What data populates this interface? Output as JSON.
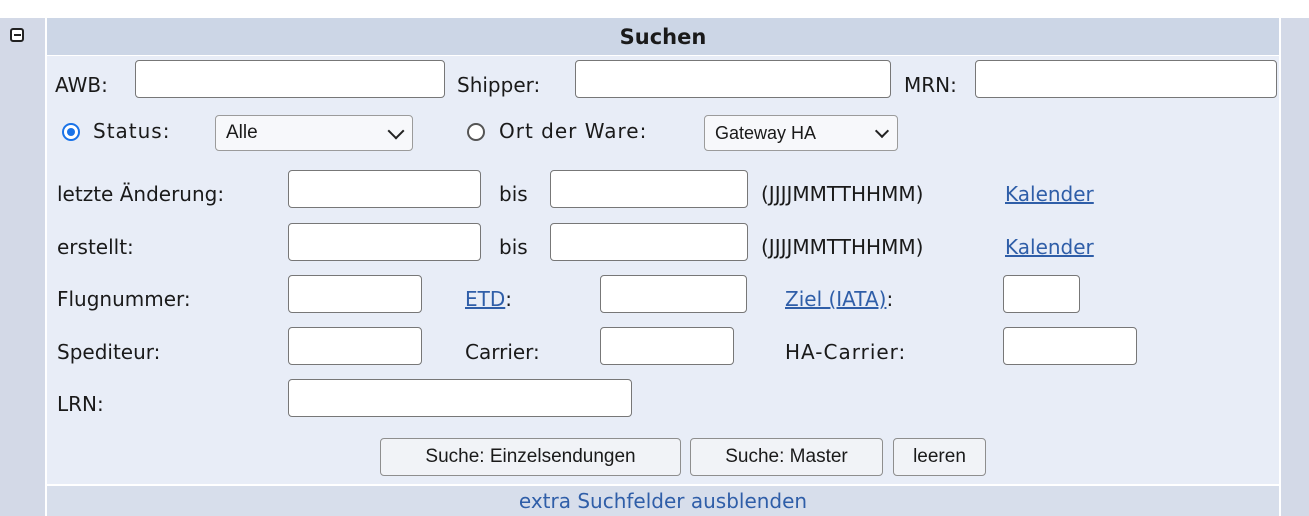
{
  "header": {
    "title": "Suchen"
  },
  "row1": {
    "awb_label": "AWB:",
    "awb_value": "",
    "shipper_label": "Shipper:",
    "shipper_value": "",
    "mrn_label": "MRN:",
    "mrn_value": ""
  },
  "row2": {
    "status_label": "Status:",
    "status_selected": "Alle",
    "status_checked": true,
    "ort_label": "Ort der Ware:",
    "ort_selected": "Gateway HA",
    "ort_checked": false
  },
  "row3": {
    "label": "letzte Änderung:",
    "bis": "bis",
    "format": "(JJJJMMTTHHMM)",
    "kalender": "Kalender"
  },
  "row4": {
    "label": "erstellt:",
    "bis": "bis",
    "format": "(JJJJMMTTHHMM)",
    "kalender": "Kalender"
  },
  "row5": {
    "flugnummer": "Flugnummer:",
    "etd": "ETD",
    "ziel": "Ziel (IATA)",
    "colon": ":"
  },
  "row6": {
    "spediteur": "Spediteur:",
    "carrier": "Carrier:",
    "ha_carrier": "HA-Carrier:"
  },
  "row7": {
    "lrn": "LRN:"
  },
  "buttons": {
    "einzel": "Suche: Einzelsendungen",
    "master": "Suche: Master",
    "leeren": "leeren"
  },
  "footer": {
    "toggle": "extra Suchfelder ausblenden"
  },
  "colors": {
    "accent": "#1a73e8",
    "link": "#2f5ea8",
    "panel": "#e8edf7",
    "header": "#ccd6e6"
  },
  "icons": {
    "collapse": "minus-box-icon",
    "dropdown": "chevron-down-icon"
  }
}
